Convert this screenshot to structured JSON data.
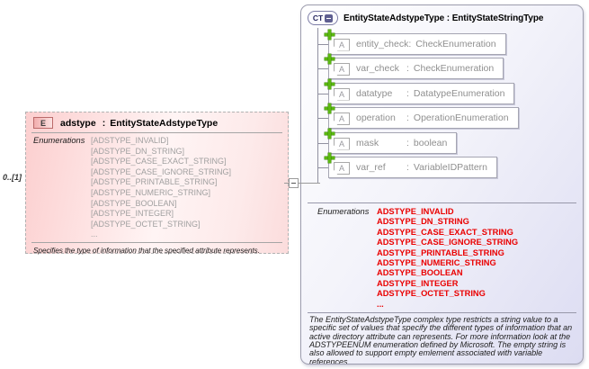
{
  "element": {
    "badge": "E",
    "name": "adstype",
    "colon": ":",
    "type": "EntityStateAdstypeType",
    "cardinality": "0..[1]",
    "enumerations_label": "Enumerations",
    "enumerations": [
      "[ADSTYPE_INVALID]",
      "[ADSTYPE_DN_STRING]",
      "[ADSTYPE_CASE_EXACT_STRING]",
      "[ADSTYPE_CASE_IGNORE_STRING]",
      "[ADSTYPE_PRINTABLE_STRING]",
      "[ADSTYPE_NUMERIC_STRING]",
      "[ADSTYPE_BOOLEAN]",
      "[ADSTYPE_INTEGER]",
      "[ADSTYPE_OCTET_STRING]",
      "..."
    ],
    "annotation": "Specifies the type of information that the specified attribute represents."
  },
  "complex_type": {
    "badge": "CT",
    "name": "EntityStateAdstypeType",
    "colon": ":",
    "base_type": "EntityStateStringType",
    "attribute_icon_label": "A",
    "attributes": [
      {
        "name": "entity_check",
        "colon": ":",
        "type": "CheckEnumeration"
      },
      {
        "name": "var_check",
        "colon": ":",
        "type": "CheckEnumeration"
      },
      {
        "name": "datatype",
        "colon": ":",
        "type": "DatatypeEnumeration"
      },
      {
        "name": "operation",
        "colon": ":",
        "type": "OperationEnumeration"
      },
      {
        "name": "mask",
        "colon": ":",
        "type": "boolean"
      },
      {
        "name": "var_ref",
        "colon": ":",
        "type": "VariableIDPattern"
      }
    ],
    "enumerations_label": "Enumerations",
    "enumerations": [
      "ADSTYPE_INVALID",
      "ADSTYPE_DN_STRING",
      "ADSTYPE_CASE_EXACT_STRING",
      "ADSTYPE_CASE_IGNORE_STRING",
      "ADSTYPE_PRINTABLE_STRING",
      "ADSTYPE_NUMERIC_STRING",
      "ADSTYPE_BOOLEAN",
      "ADSTYPE_INTEGER",
      "ADSTYPE_OCTET_STRING",
      "..."
    ],
    "annotation": "The EntityStateAdstypeType complex type restricts a string value to a specific set of values that specify the different types of information that an active directory attribute can represents. For more information look at the ADSTYPEENUM enumeration defined by Microsoft. The empty string is also allowed to support empty emlement associated with variable references."
  },
  "colors": {
    "enum_red": "#ea0000",
    "element_pink": "#fccfcf",
    "type_lavender": "#dcdcf2",
    "attr_plus_green": "#5ab810"
  }
}
